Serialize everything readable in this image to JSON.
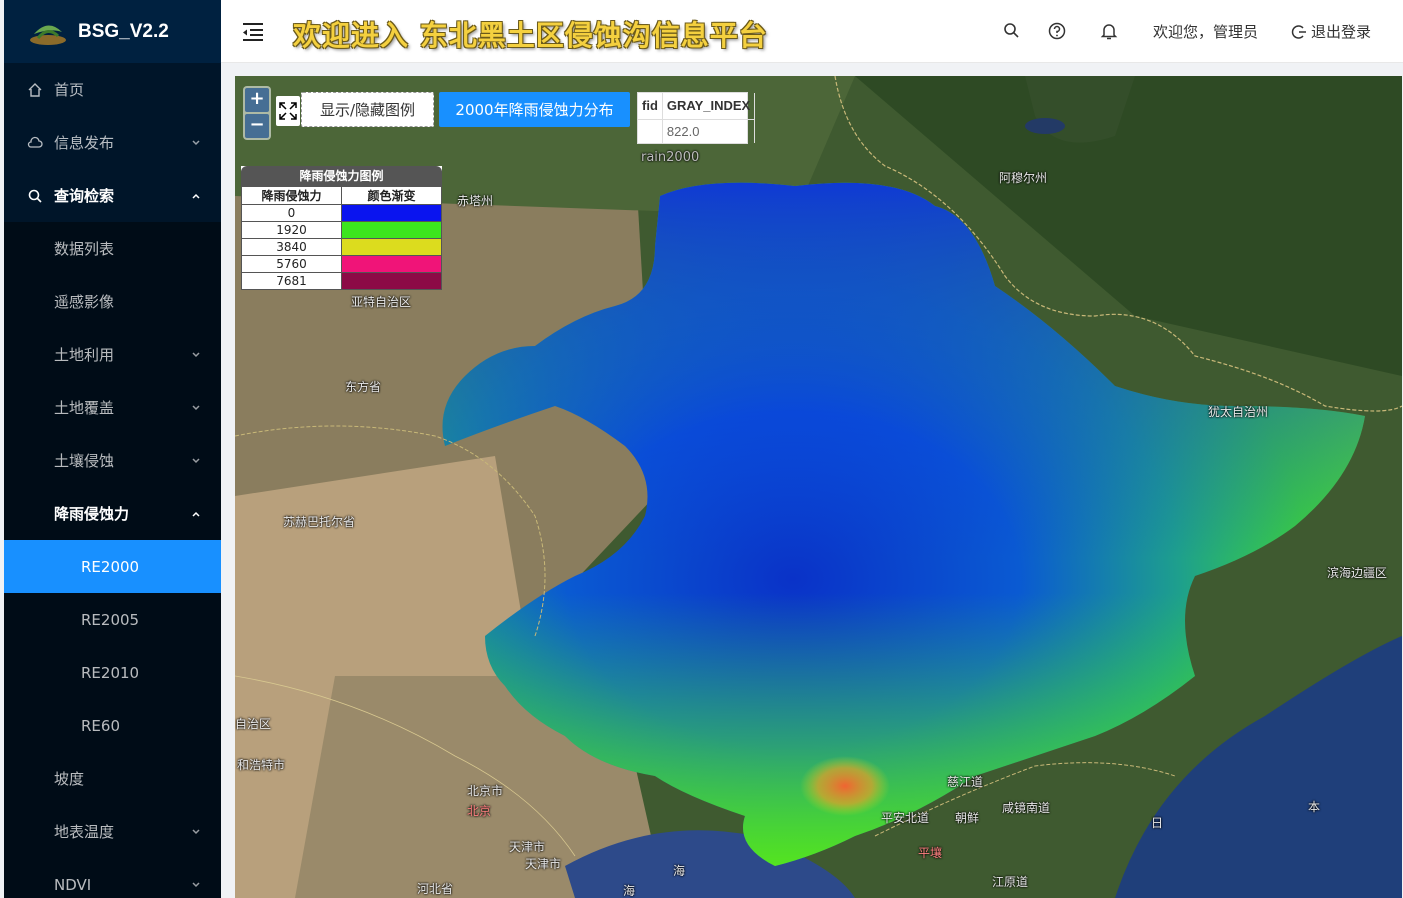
{
  "app": {
    "name": "BSG_V2.2",
    "title": "欢迎进入 东北黑土区侵蚀沟信息平台"
  },
  "header": {
    "welcome": "欢迎您，管理员",
    "logout": "退出登录"
  },
  "sidebar": {
    "items": [
      {
        "label": "首页"
      },
      {
        "label": "信息发布"
      },
      {
        "label": "查询检索"
      },
      {
        "label": "数据列表"
      },
      {
        "label": "遥感影像"
      },
      {
        "label": "土地利用"
      },
      {
        "label": "土地覆盖"
      },
      {
        "label": "土壤侵蚀"
      },
      {
        "label": "降雨侵蚀力"
      },
      {
        "label": "RE2000"
      },
      {
        "label": "RE2005"
      },
      {
        "label": "RE2010"
      },
      {
        "label": "RE60"
      },
      {
        "label": "坡度"
      },
      {
        "label": "地表温度"
      },
      {
        "label": "NDVI"
      }
    ]
  },
  "map": {
    "zoom_in": "+",
    "zoom_out": "−",
    "toggle_legend": "显示/隐藏图例",
    "layer_button": "2000年降雨侵蚀力分布",
    "attr": {
      "col1": "fid",
      "col2": "GRAY_INDEX",
      "val1": "",
      "val2": "822.0"
    },
    "layer_label": "rain2000",
    "legend": {
      "title": "降雨侵蚀力图例",
      "head1": "降雨侵蚀力",
      "head2": "颜色渐变",
      "rows": [
        {
          "value": "0",
          "color": "#0a14ef"
        },
        {
          "value": "1920",
          "color": "#3ce61e"
        },
        {
          "value": "3840",
          "color": "#dcdc1e"
        },
        {
          "value": "5760",
          "color": "#f01478"
        },
        {
          "value": "7681",
          "color": "#8c0a46"
        }
      ]
    },
    "places": {
      "chifeng": "赤塔州",
      "amur": "阿穆尔州",
      "inner": "亚特自治区",
      "dongfang": "东方省",
      "jewish": "犹太自治州",
      "sukhbaatar": "苏赫巴托尔省",
      "primorsky": "滨海边疆区",
      "auto": "自治区",
      "hohhot": "和浩特市",
      "beijing_city": "北京市",
      "beijing": "北京",
      "tianjin_city": "天津市",
      "tianjin": "天津市",
      "hebei": "河北省",
      "cijiang": "慈江道",
      "pyongan": "平安北道",
      "korea": "朝鲜",
      "hamgyong": "咸镜南道",
      "pyongyang": "平壤",
      "gangwon": "江原道",
      "sea1": "海",
      "sea2": "海",
      "sea3": "日",
      "sea4": "本"
    }
  }
}
